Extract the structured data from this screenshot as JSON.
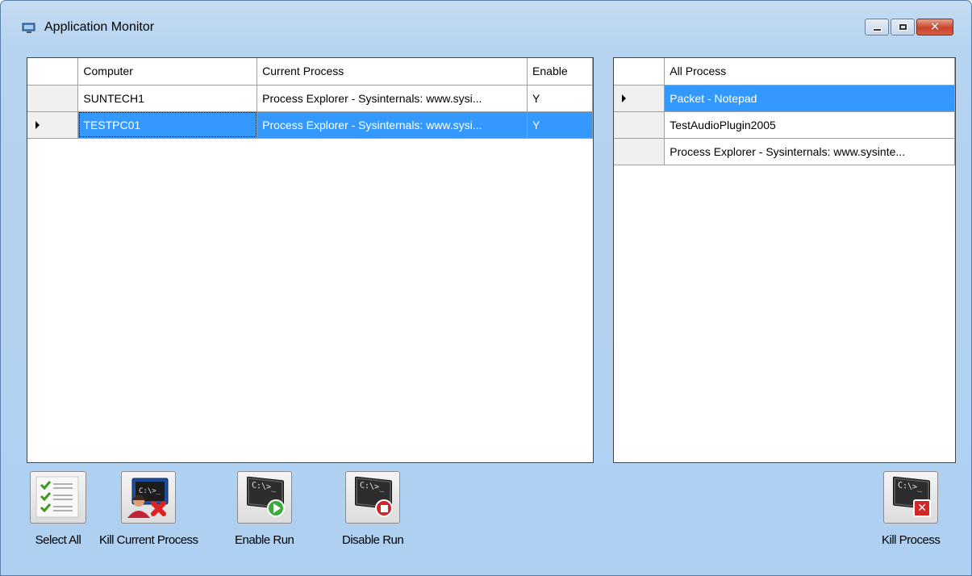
{
  "window": {
    "title": "Application Monitor"
  },
  "computers_grid": {
    "columns": [
      "Computer",
      "Current Process",
      "Enable"
    ],
    "rows": [
      {
        "computer": "SUNTECH1",
        "current_process": "Process Explorer - Sysinternals: www.sysi...",
        "enable": "Y",
        "selected": false
      },
      {
        "computer": "TESTPC01",
        "current_process": "Process Explorer - Sysinternals: www.sysi...",
        "enable": "Y",
        "selected": true
      }
    ]
  },
  "process_grid": {
    "columns": [
      "All Process"
    ],
    "rows": [
      {
        "process": "Packet - Notepad",
        "selected": true
      },
      {
        "process": "TestAudioPlugin2005",
        "selected": false
      },
      {
        "process": "Process Explorer - Sysinternals: www.sysinte...",
        "selected": false
      }
    ]
  },
  "toolbar": {
    "select_all": "Select All",
    "kill_current_process": "Kill Current Process",
    "enable_run": "Enable Run",
    "disable_run": "Disable Run",
    "kill_process": "Kill Process",
    "terminal_glyph": "C:\\>_"
  },
  "icons": {
    "app": "monitor-icon",
    "select_all": "checklist-icon",
    "kill_current_process": "user-terminal-x-icon",
    "enable_run": "terminal-play-icon",
    "disable_run": "terminal-stop-icon",
    "kill_process": "terminal-x-icon"
  },
  "colors": {
    "selection": "#3399ff",
    "window_bg": "#b6d3f0",
    "close_button": "#c8442b"
  }
}
